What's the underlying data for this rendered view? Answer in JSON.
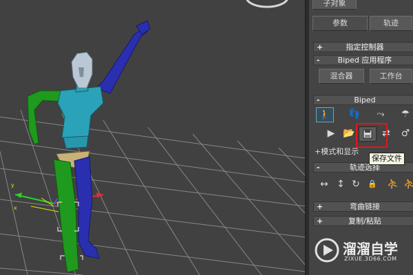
{
  "panel": {
    "tab_sub_object": "子对象",
    "tab_params": "参数",
    "tab_track": "轨迹",
    "rollouts": {
      "assign_controller": "指定控制器",
      "biped_apps": "Biped 应用程序",
      "biped": "Biped",
      "mode_display": "+模式和显示",
      "track_selection": "轨迹选择",
      "bend_links": "弯曲链接",
      "copy_paste": "复制/粘贴"
    },
    "signs": {
      "plus": "+",
      "minus": "-"
    },
    "buttons": {
      "mixer": "混合器",
      "workbench": "工作台"
    },
    "icons": {
      "figure_mode": "figure-mode-icon",
      "footstep_mode": "footstep-mode-icon",
      "motion_flow": "motion-flow-icon",
      "mixer_mode": "mixer-mode-icon",
      "play_biped": "play-biped-icon",
      "load_file": "load-file-icon",
      "save_file": "save-file-icon",
      "convert": "convert-icon",
      "move_all": "move-all-icon"
    },
    "track_icons": [
      "horizontal-move-icon",
      "vertical-move-icon",
      "rotate-icon",
      "lock-icon",
      "select-symmetrical-icon",
      "select-opposite-icon"
    ]
  },
  "tooltip": "保存文件",
  "watermark": {
    "brand": "溜溜自学",
    "url": "ZIXUE.3D66.COM"
  },
  "colors": {
    "highlight": "#e01818",
    "biped_green": "#1f9a1f",
    "biped_blue": "#2a2fb0",
    "biped_cyan": "#2aa3b8",
    "viewport_bg": "#414141"
  }
}
